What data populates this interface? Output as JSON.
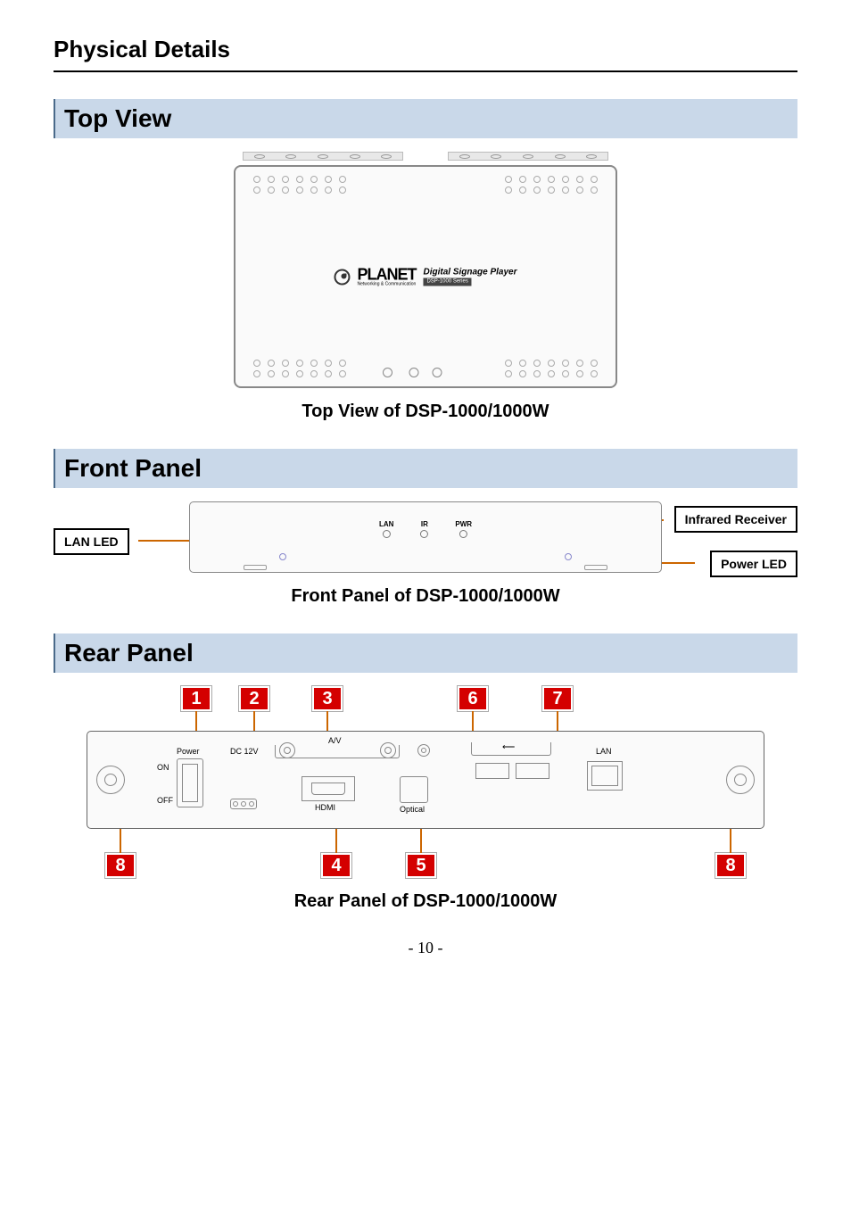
{
  "title": "Physical Details",
  "sections": {
    "top_view": "Top View",
    "front_panel": "Front Panel",
    "rear_panel": "Rear Panel"
  },
  "captions": {
    "top": "Top View of DSP-1000/1000W",
    "front": "Front Panel of DSP-1000/1000W",
    "rear": "Rear Panel of DSP-1000/1000W"
  },
  "logo": {
    "brand": "PLANET",
    "tagline": "Networking & Communication",
    "product_title": "Digital Signage Player",
    "series": "DSP-1000 Series"
  },
  "front_panel": {
    "lan_label": "LAN",
    "ir_label": "IR",
    "pwr_label": "PWR",
    "callout_lan": "LAN LED",
    "callout_ir": "Infrared Receiver",
    "callout_pwr": "Power LED"
  },
  "rear_panel": {
    "power": "Power",
    "on": "ON",
    "off": "OFF",
    "dc12v": "DC 12V",
    "av": "A/V",
    "hdmi": "HDMI",
    "optical": "Optical",
    "usb_icon": "⟵",
    "lan": "LAN",
    "badges": {
      "1": "1",
      "2": "2",
      "3": "3",
      "4": "4",
      "5": "5",
      "6": "6",
      "7": "7",
      "8": "8"
    }
  },
  "page_number": "- 10 -"
}
